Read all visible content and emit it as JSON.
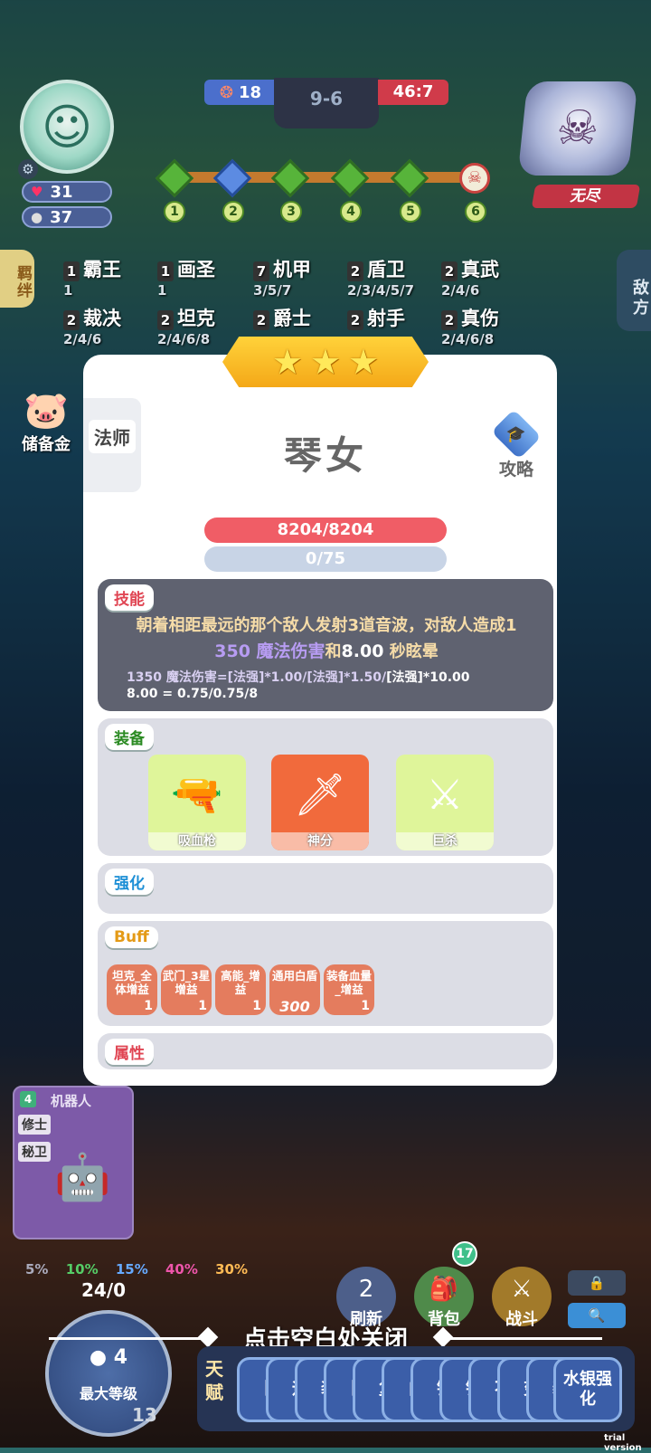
{
  "player": {
    "hp": "31",
    "gold": "37"
  },
  "score": {
    "left": "18",
    "round": "9-6",
    "right": "46:7"
  },
  "opponent": {
    "label": "无尽"
  },
  "stages": [
    "1",
    "2",
    "3",
    "4",
    "5",
    "6"
  ],
  "side_tabs": {
    "left": "羁绊",
    "right": "敌方"
  },
  "synergies": [
    {
      "n": "1",
      "name": "霸王",
      "sub": "1"
    },
    {
      "n": "1",
      "name": "画圣",
      "sub": "1"
    },
    {
      "n": "7",
      "name": "机甲",
      "sub": "3/5/7"
    },
    {
      "n": "2",
      "name": "盾卫",
      "sub": "2/3/4/5/7"
    },
    {
      "n": "2",
      "name": "真武",
      "sub": "2/4/6"
    },
    {
      "n": "2",
      "name": "裁决",
      "sub": "2/4/6"
    },
    {
      "n": "2",
      "name": "坦克",
      "sub": "2/4/6/8"
    },
    {
      "n": "2",
      "name": "爵士",
      "sub": ""
    },
    {
      "n": "2",
      "name": "射手",
      "sub": ""
    },
    {
      "n": "2",
      "name": "真伤",
      "sub": "2/4/6/8"
    }
  ],
  "piggy_label": "储备金",
  "modal": {
    "stars": 3,
    "class_tag": "法师",
    "hero_name": "琴女",
    "guide_label": "攻略",
    "hp": "8204/8204",
    "mana": "0/75",
    "skill": {
      "title": "技能",
      "desc_a": "朝着相距最远的那个敌人发射3道音波，对敌人造成1",
      "desc_dmg": "350 魔法伤害",
      "desc_and": "和",
      "desc_stun": "8.00",
      "desc_end": " 秒眩晕",
      "formula_1": "1350 魔法伤害=[法强]*1.00/[法强]*1.50/",
      "formula_1b": "[法强]*10.00",
      "formula_2": "8.00 = 0.75/0.75/8"
    },
    "equipment": {
      "title": "装备",
      "items": [
        {
          "name": "吸血枪",
          "icon": "gun-icon",
          "color": "#dff59a"
        },
        {
          "name": "神分",
          "icon": "dagger-icon",
          "color": "#f16a3c"
        },
        {
          "name": "巨杀",
          "icon": "greatsword-icon",
          "color": "#dff59a"
        }
      ]
    },
    "enhance": {
      "title": "强化"
    },
    "buff": {
      "title": "Buff",
      "chips": [
        {
          "name": "坦克_全体增益",
          "value": "1"
        },
        {
          "name": "武门_3星增益",
          "value": "1"
        },
        {
          "name": "高能_增益",
          "value": "1"
        },
        {
          "name": "通用白盾",
          "value": "300"
        },
        {
          "name": "装备血量_增益",
          "value": "1"
        }
      ]
    },
    "attrs": {
      "title": "属性"
    }
  },
  "bench": {
    "cost": "4",
    "name": "机器人",
    "tags": [
      "修士",
      "秘卫"
    ]
  },
  "odds": [
    "5%",
    "10%",
    "15%",
    "40%",
    "30%"
  ],
  "level": {
    "xp": "24/0",
    "coin": "4",
    "label": "最大等级",
    "num": "13"
  },
  "actions": {
    "refresh": "刷新",
    "refresh_cost": "2",
    "bag": "背包",
    "bag_badge": "17",
    "battle": "战斗"
  },
  "close_hint": "点击空白处关闭",
  "talent": {
    "label": "天赋",
    "cards": [
      "【】",
      "运",
      "装",
      "【】",
      "复",
      "自",
      "铲",
      "钢",
      "不",
      "变",
      "装",
      "水银强化"
    ]
  },
  "watermark": "trial version"
}
